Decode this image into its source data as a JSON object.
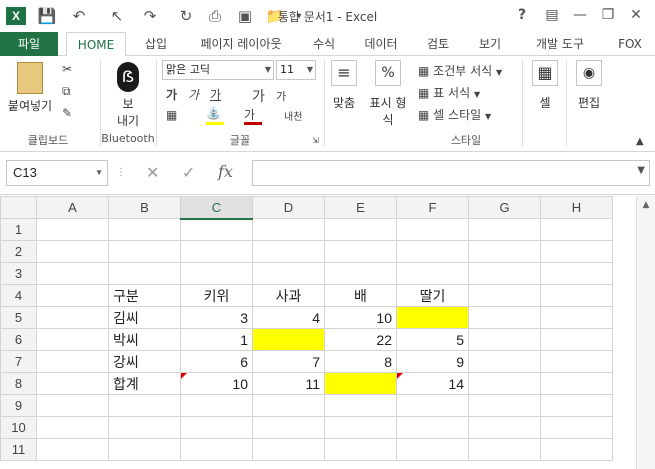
{
  "window": {
    "title": "통합 문서1 - Excel",
    "help": "?",
    "app_icon": "X"
  },
  "ribbon_tabs": [
    "파일",
    "HOME",
    "삽입",
    "페이지 레이아웃",
    "수식",
    "데이터",
    "검토",
    "보기",
    "개발 도구",
    "FOX"
  ],
  "ribbon": {
    "paste": "붙여넣기",
    "bluetooth_btn_1": "보",
    "bluetooth_btn_2": "내기",
    "font_name": "맑은 고딕",
    "font_size": "11",
    "bold": "가",
    "italic": "가",
    "underline": "가",
    "grow": "가",
    "shrink": "가",
    "font_color": "가",
    "phonetic": "내천",
    "align": "맞춤",
    "number_1": "표시 형",
    "number_2": "식",
    "cond_format": "조건부 서식",
    "table_format": "표 서식",
    "cell_style": "셀 스타일",
    "cells": "셀",
    "edit": "편집",
    "groups": {
      "clipboard": "클립보드",
      "bluetooth": "Bluetooth",
      "font": "글꼴",
      "style": "스타일"
    }
  },
  "formula_bar": {
    "name_box": "C13",
    "fx": "fx",
    "value": ""
  },
  "sheet": {
    "columns": [
      "A",
      "B",
      "C",
      "D",
      "E",
      "F",
      "G",
      "H"
    ],
    "selected_column": "C",
    "rows": [
      {
        "n": "1",
        "cells": [
          "",
          "",
          "",
          "",
          "",
          "",
          "",
          ""
        ]
      },
      {
        "n": "2",
        "cells": [
          "",
          "",
          "",
          "",
          "",
          "",
          "",
          ""
        ]
      },
      {
        "n": "3",
        "cells": [
          "",
          "",
          "",
          "",
          "",
          "",
          "",
          ""
        ]
      },
      {
        "n": "4",
        "cells": [
          "",
          "구분",
          "키위",
          "사과",
          "배",
          "딸기",
          "",
          ""
        ]
      },
      {
        "n": "5",
        "cells": [
          "",
          "김씨",
          "3",
          "4",
          "10",
          "",
          "",
          ""
        ]
      },
      {
        "n": "6",
        "cells": [
          "",
          "박씨",
          "1",
          "",
          "22",
          "5",
          "",
          ""
        ]
      },
      {
        "n": "7",
        "cells": [
          "",
          "강씨",
          "6",
          "7",
          "8",
          "9",
          "",
          ""
        ]
      },
      {
        "n": "8",
        "cells": [
          "",
          "합계",
          "10",
          "11",
          "",
          "14",
          "",
          ""
        ]
      },
      {
        "n": "9",
        "cells": [
          "",
          "",
          "",
          "",
          "",
          "",
          "",
          ""
        ]
      },
      {
        "n": "10",
        "cells": [
          "",
          "",
          "",
          "",
          "",
          "",
          "",
          ""
        ]
      },
      {
        "n": "11",
        "cells": [
          "",
          "",
          "",
          "",
          "",
          "",
          "",
          ""
        ]
      }
    ],
    "highlight_color": "#ffff00",
    "accent_color": "#217346"
  }
}
